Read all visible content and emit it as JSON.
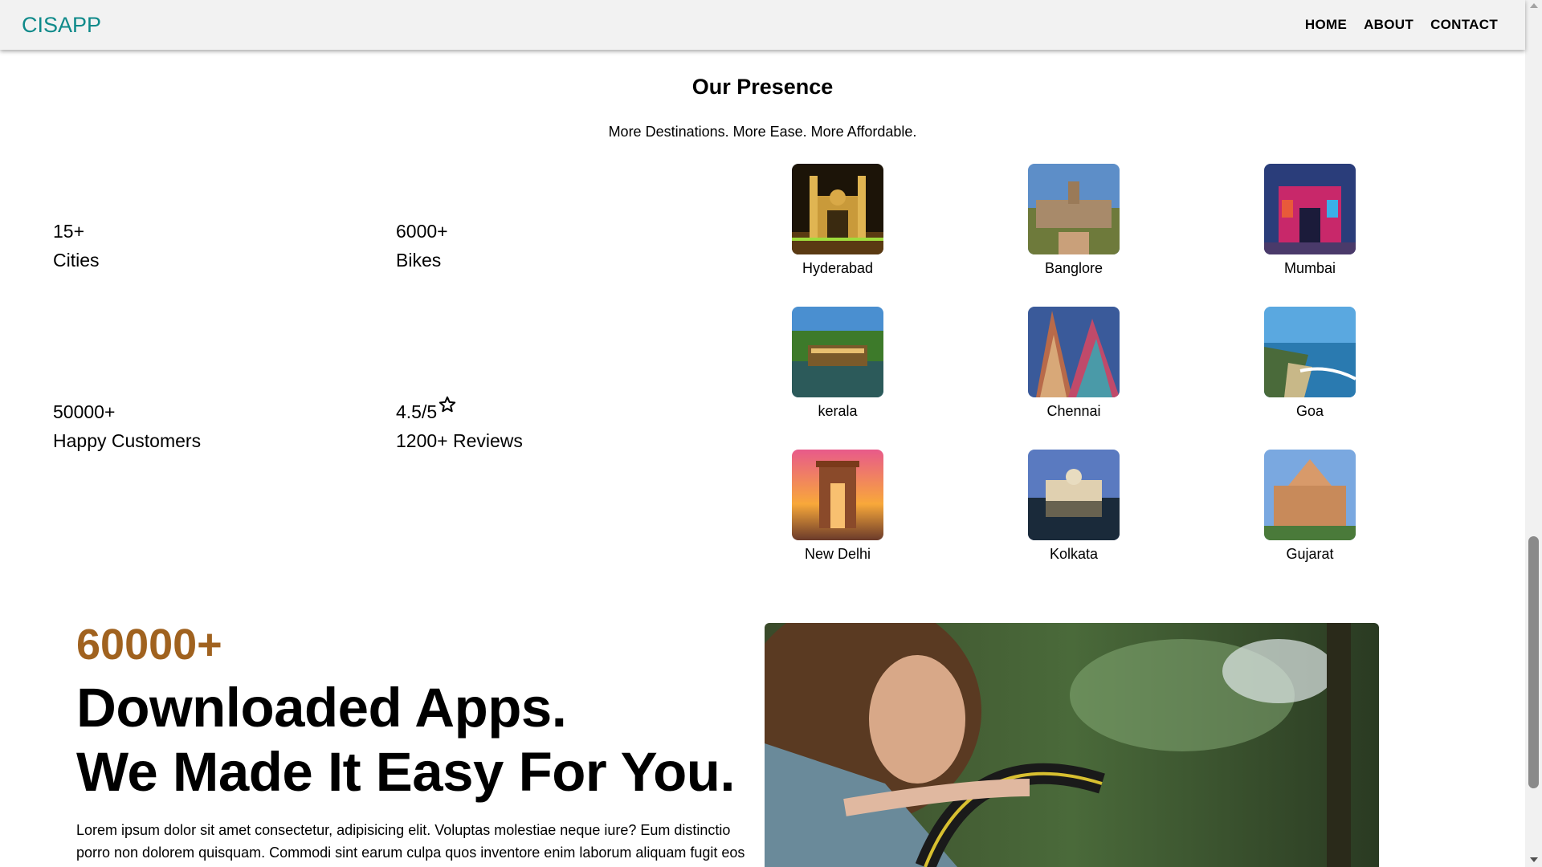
{
  "navbar": {
    "brand": "CISAPP",
    "links": [
      "HOME",
      "ABOUT",
      "CONTACT"
    ]
  },
  "presence": {
    "title": "Our Presence",
    "subtitle": "More Destinations. More Ease. More Affordable.",
    "stats": [
      {
        "value": "15+",
        "label": "Cities"
      },
      {
        "value": "6000+",
        "label": "Bikes"
      },
      {
        "value": "50000+",
        "label": "Happy Customers"
      },
      {
        "value": "4.5/5",
        "label": "1200+ Reviews",
        "icon": "star-icon"
      }
    ],
    "cities": [
      "Hyderabad",
      "Banglore",
      "Mumbai",
      "kerala",
      "Chennai",
      "Goa",
      "New Delhi",
      "Kolkata",
      "Gujarat"
    ]
  },
  "hero": {
    "number": "60000+",
    "line1": "Downloaded Apps.",
    "line2": "We Made It Easy For You.",
    "text": "Lorem ipsum dolor sit amet consectetur, adipisicing elit. Voluptas molestiae neque iure? Eum distinctio porro non dolorem quisquam. Commodi sint earum culpa quos inventore enim laborum aliquam fugit eos"
  },
  "colors": {
    "brand": "#0f8a8a",
    "accent": "#a0621f"
  }
}
